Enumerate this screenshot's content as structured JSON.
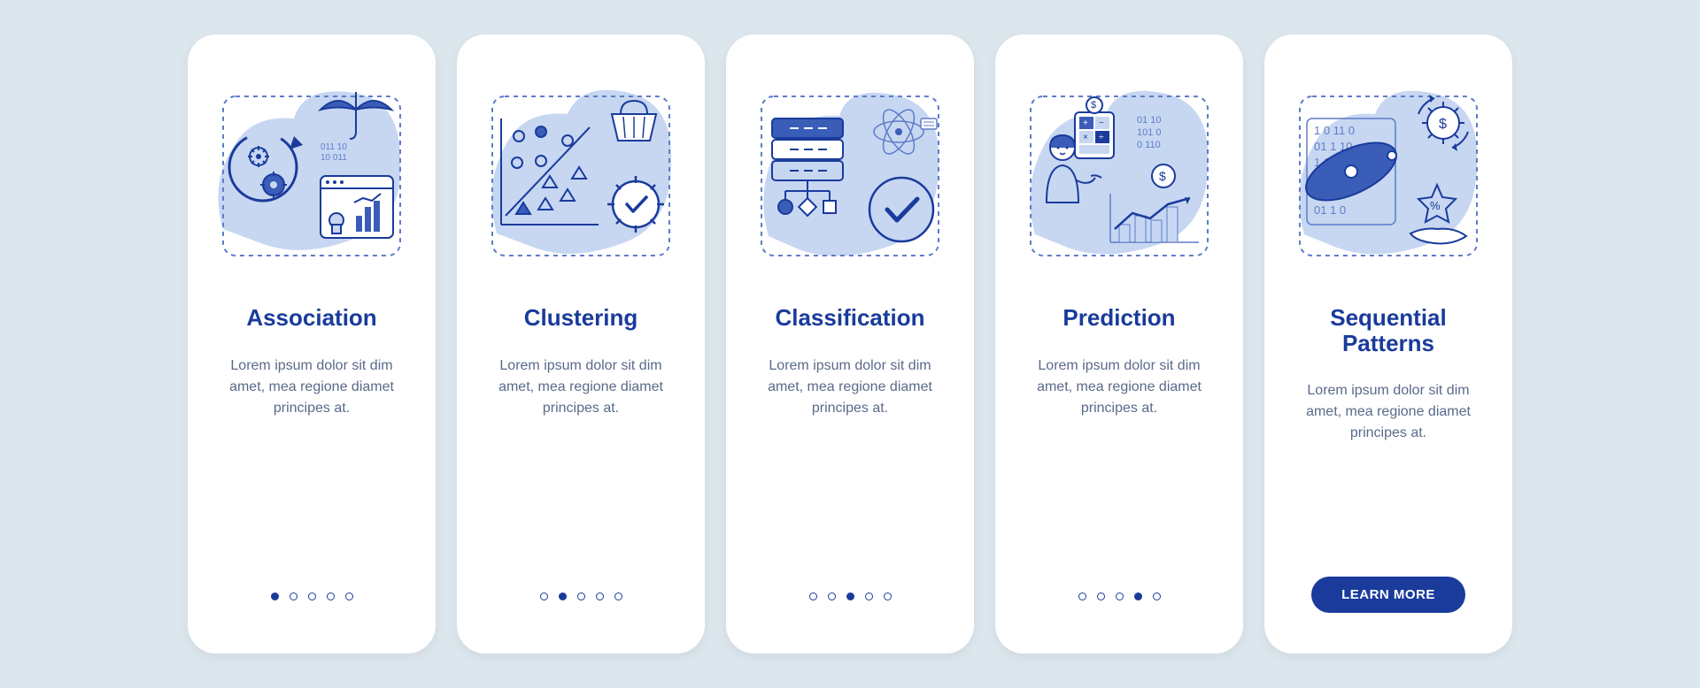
{
  "cards": [
    {
      "title": "Association",
      "desc": "Lorem ipsum dolor sit dim amet, mea regione diamet principes at.",
      "activeDot": 0,
      "hasCta": false
    },
    {
      "title": "Clustering",
      "desc": "Lorem ipsum dolor sit dim amet, mea regione diamet principes at.",
      "activeDot": 1,
      "hasCta": false
    },
    {
      "title": "Classification",
      "desc": "Lorem ipsum dolor sit dim amet, mea regione diamet principes at.",
      "activeDot": 2,
      "hasCta": false
    },
    {
      "title": "Prediction",
      "desc": "Lorem ipsum dolor sit dim amet, mea regione diamet principes at.",
      "activeDot": 3,
      "hasCta": false
    },
    {
      "title": "Sequential Patterns",
      "desc": "Lorem ipsum dolor sit dim amet, mea regione diamet principes at.",
      "activeDot": 4,
      "hasCta": true
    }
  ],
  "ctaLabel": "LEARN MORE",
  "colors": {
    "accent": "#1a3b9c",
    "blobLight": "#c7d7f2",
    "lineBlue": "#5e7cc8",
    "fillBlue": "#3a5db8"
  }
}
